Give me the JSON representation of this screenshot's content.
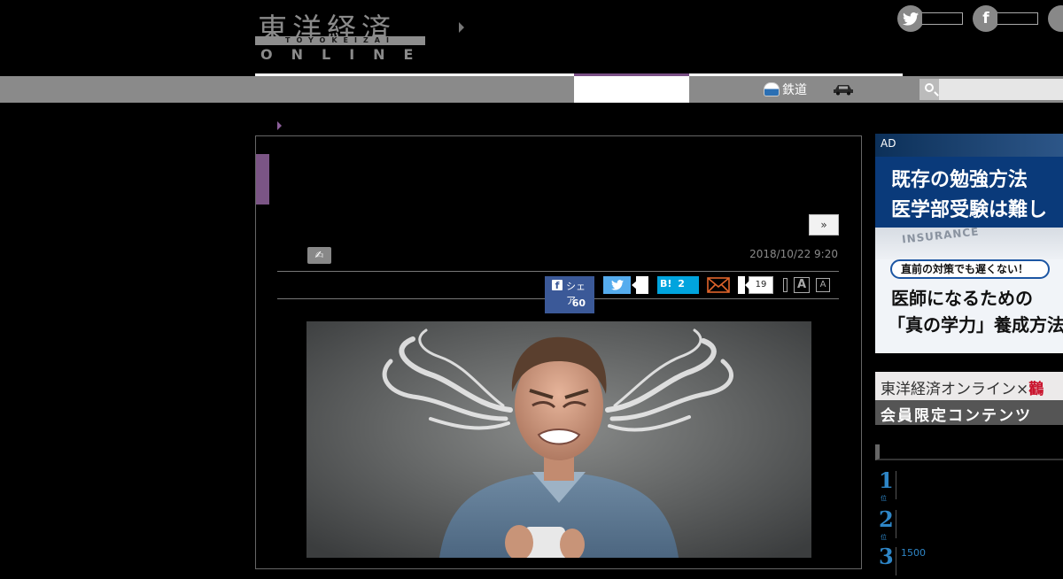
{
  "header": {
    "logo_kanji": "東洋経済",
    "logo_band": "TOYOKEIZAI",
    "logo_online": "ONLINE"
  },
  "nav": {
    "rail_label": "鉄道"
  },
  "search": {
    "placeholder": ""
  },
  "article": {
    "date": "2018/10/22 9:20",
    "more_label": "»"
  },
  "share": {
    "facebook_label": "シェア",
    "facebook_count": "60",
    "hatena_label": "B!",
    "hatena_count": "2",
    "comment_count": "19",
    "font_large": "A",
    "font_small": "A"
  },
  "ad": {
    "label": "AD",
    "line1": "既存の勉強方法",
    "line2": "医学部受験は難し",
    "paper_text": "INSURANCE",
    "pill": "直前の対策でも遅くない！",
    "line3": "医師になるための",
    "line4": "「真の学力」養成方法"
  },
  "member": {
    "line1_main": "東洋経済オンライン×",
    "line1_red": "鸛",
    "line2": "会員限定コンテンツ"
  },
  "ranking": [
    {
      "num": "1",
      "sub": "位",
      "text": ""
    },
    {
      "num": "2",
      "sub": "位",
      "text": ""
    },
    {
      "num": "3",
      "sub": "",
      "text": "1500"
    }
  ],
  "colors": {
    "accent_purple": "#7b5585",
    "facebook": "#3b5998",
    "twitter": "#55acee",
    "hatena": "#00a4de",
    "rank_blue": "#2e86c7"
  }
}
